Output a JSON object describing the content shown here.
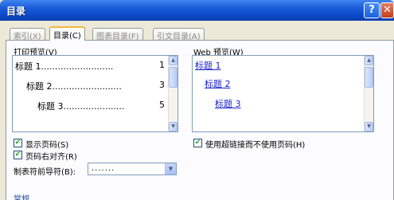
{
  "window": {
    "title": "目录",
    "help_glyph": "?",
    "close_glyph": "✕"
  },
  "tabs": [
    {
      "label": "索引(X)"
    },
    {
      "label": "目录(C)"
    },
    {
      "label": "图表目录(F)"
    },
    {
      "label": "引文目录(A)"
    }
  ],
  "print_preview": {
    "label": "打印预览(V)",
    "entries": [
      {
        "text": "标题 1",
        "dots": "..........................",
        "page": "1"
      },
      {
        "text": "标题 2",
        "dots": ".........................",
        "page": "3"
      },
      {
        "text": "标题 3",
        "dots": "......................",
        "page": "5"
      }
    ]
  },
  "web_preview": {
    "label": "Web 预览(W)",
    "links": [
      "标题 1",
      "标题 2",
      "标题 3"
    ]
  },
  "options": {
    "show_page_numbers": {
      "label": "显示页码(S)",
      "checked": true
    },
    "right_align": {
      "label": "页码右对齐(R)",
      "checked": true
    },
    "tab_leader": {
      "label": "制表符前导符(B):",
      "value": "......."
    },
    "use_hyperlinks": {
      "label": "使用超链接而不使用页码(H)",
      "checked": true
    }
  },
  "footer": {
    "general_label": "常规"
  },
  "icons": {
    "scroll_up": "▲",
    "scroll_down": "▼",
    "dropdown": "▼",
    "check": "✔"
  }
}
